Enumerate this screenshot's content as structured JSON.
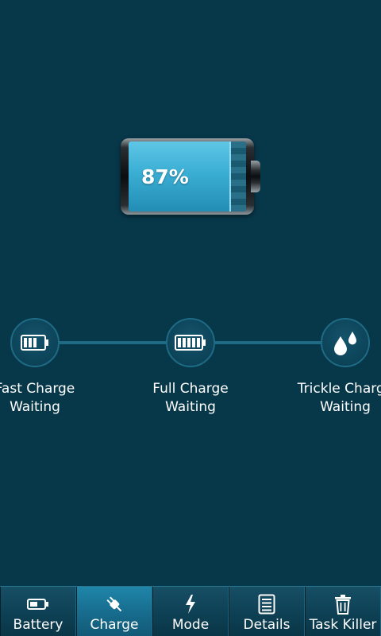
{
  "battery": {
    "level_percent": 87,
    "label": "87%",
    "fill_color": "#3aaed4"
  },
  "stages": [
    {
      "title": "Fast Charge",
      "status": "Waiting",
      "icon": "battery-low-icon"
    },
    {
      "title": "Full Charge",
      "status": "Waiting",
      "icon": "battery-full-icon"
    },
    {
      "title": "Trickle Charge",
      "status": "Waiting",
      "icon": "droplets-icon"
    }
  ],
  "tabs": [
    {
      "label": "Battery",
      "icon": "battery-icon",
      "active": false
    },
    {
      "label": "Charge",
      "icon": "plug-icon",
      "active": true
    },
    {
      "label": "Mode",
      "icon": "lightning-icon",
      "active": false
    },
    {
      "label": "Details",
      "icon": "list-icon",
      "active": false
    },
    {
      "label": "Task Killer",
      "icon": "trash-icon",
      "active": false
    }
  ],
  "colors": {
    "background": "#07384a",
    "accent": "#1f86aa"
  }
}
